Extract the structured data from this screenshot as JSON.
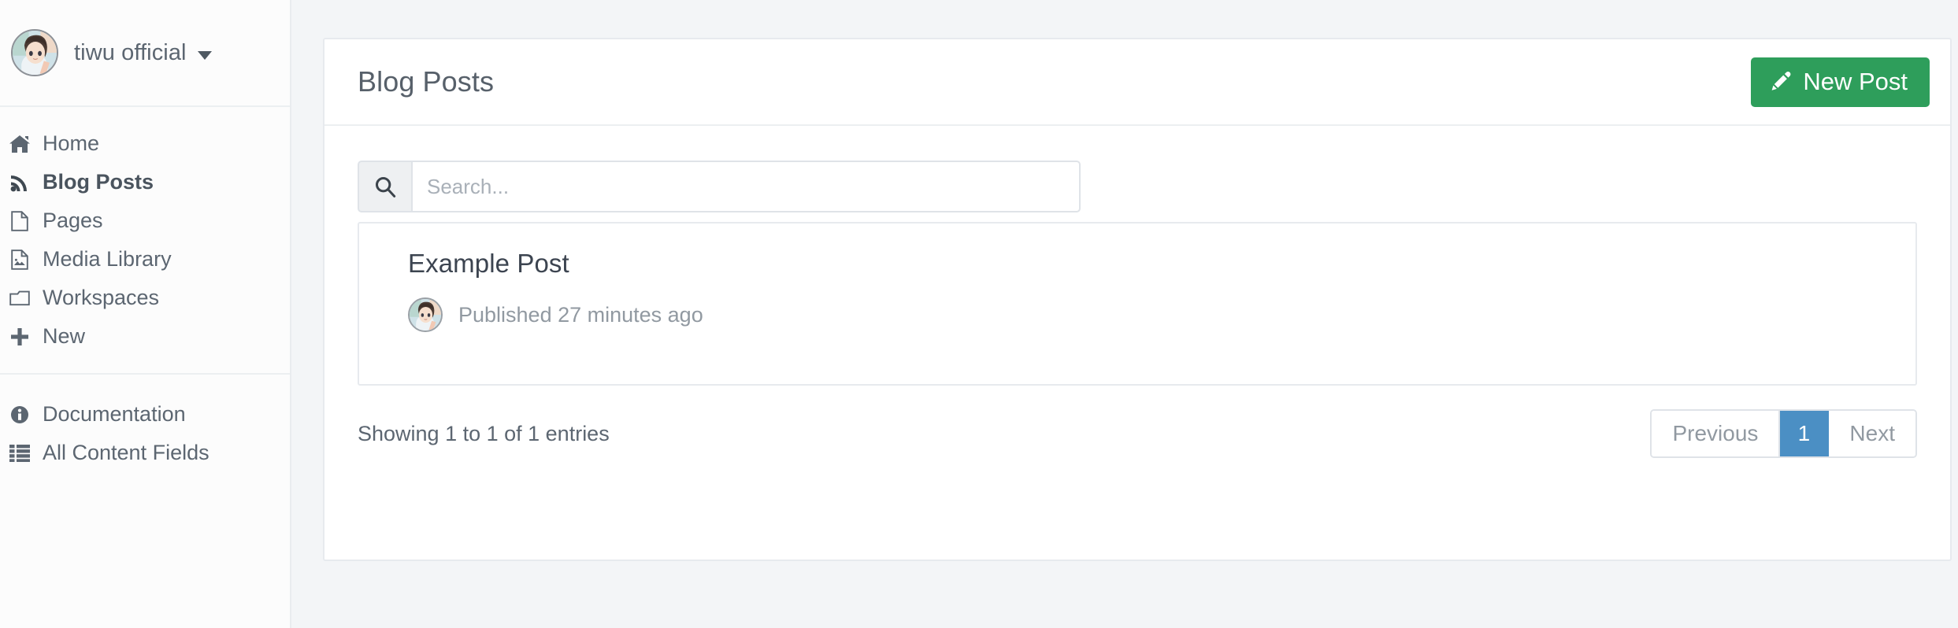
{
  "sidebar": {
    "account": {
      "name": "tiwu official",
      "avatar_icon": "user-avatar-anime",
      "caret_icon": "caret-down-icon"
    },
    "primary_items": [
      {
        "label": "Home",
        "icon": "home-icon",
        "active": false
      },
      {
        "label": "Blog Posts",
        "icon": "rss-icon",
        "active": true
      },
      {
        "label": "Pages",
        "icon": "file-icon",
        "active": false
      },
      {
        "label": "Media Library",
        "icon": "image-file-icon",
        "active": false
      },
      {
        "label": "Workspaces",
        "icon": "folder-icon",
        "active": false
      },
      {
        "label": "New",
        "icon": "plus-icon",
        "active": false
      }
    ],
    "secondary_items": [
      {
        "label": "Documentation",
        "icon": "info-circle-icon"
      },
      {
        "label": "All Content Fields",
        "icon": "list-icon"
      }
    ]
  },
  "main": {
    "header": {
      "title": "Blog Posts",
      "new_post_label": "New Post",
      "new_post_icon": "pencil-icon",
      "new_post_color": "#2e9e5b"
    },
    "search": {
      "placeholder": "Search...",
      "value": "",
      "icon": "search-icon"
    },
    "posts": [
      {
        "title": "Example Post",
        "meta": "Published 27 minutes ago",
        "avatar_icon": "user-avatar-anime"
      }
    ],
    "footer": {
      "entries_info": "Showing 1 to 1 of 1 entries",
      "pagination": {
        "previous_label": "Previous",
        "next_label": "Next",
        "pages": [
          "1"
        ],
        "active_page": "1",
        "active_color": "#4b8fc4"
      }
    }
  }
}
